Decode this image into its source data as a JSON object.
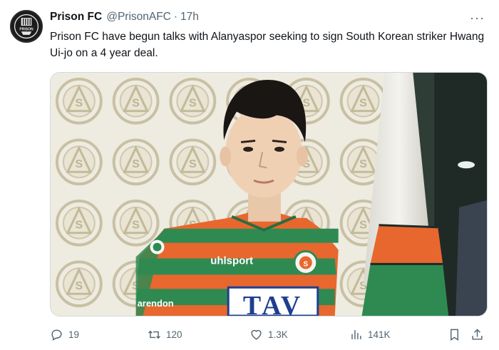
{
  "author": {
    "display_name": "Prison FC",
    "handle": "@PrisonAFC",
    "separator": "·",
    "time": "17h",
    "avatar_text": "PRISON"
  },
  "more_label": "···",
  "tweet": {
    "text": "Prison FC have begun talks with Alanyaspor seeking to sign South Korean striker Hwang Ui-jo on a 4 year deal."
  },
  "media": {
    "jersey_brand": "uhlsport",
    "jersey_sponsor": "TAV",
    "jersey_sleeve": "arendon",
    "crest_letter": "S"
  },
  "actions": {
    "replies": "19",
    "retweets": "120",
    "likes": "1.3K",
    "views": "141K"
  },
  "colors": {
    "text": "#0f1419",
    "muted": "#536471",
    "jersey_orange": "#e8672e",
    "jersey_green": "#2f8a52"
  }
}
